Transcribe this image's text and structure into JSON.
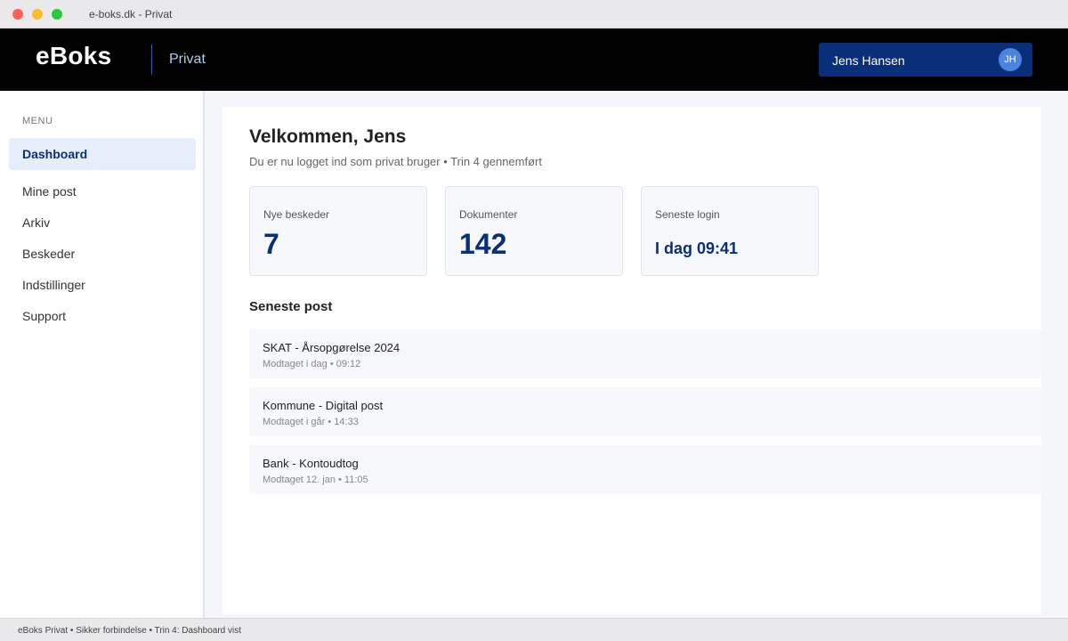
{
  "window": {
    "title": "e-boks.dk - Privat"
  },
  "header": {
    "logo": "eBoks",
    "section": "Privat",
    "user": {
      "name": "Jens Hansen",
      "initials": "JH"
    }
  },
  "sidebar": {
    "heading": "MENU",
    "items": [
      {
        "label": "Dashboard",
        "active": true
      },
      {
        "label": "Mine post"
      },
      {
        "label": "Arkiv"
      },
      {
        "label": "Beskeder"
      },
      {
        "label": "Indstillinger"
      },
      {
        "label": "Support"
      }
    ]
  },
  "main": {
    "title": "Velkommen, Jens",
    "subtitle": "Du er nu logget ind som privat bruger • Trin 4 gennemført",
    "stats": [
      {
        "label": "Nye beskeder",
        "value": "7"
      },
      {
        "label": "Dokumenter",
        "value": "142"
      },
      {
        "label": "Seneste login",
        "value": "I dag 09:41"
      }
    ],
    "recent_heading": "Seneste post",
    "recent": [
      {
        "title": "SKAT - Årsopgørelse 2024",
        "meta": "Modtaget i dag • 09:12"
      },
      {
        "title": "Kommune - Digital post",
        "meta": "Modtaget i går • 14:33"
      },
      {
        "title": "Bank - Kontoudtog",
        "meta": "Modtaget 12. jan • 11:05"
      }
    ]
  },
  "statusbar": {
    "text": "eBoks Privat • Sikker forbindelse • Trin 4: Dashboard vist"
  },
  "colors": {
    "brand_dark": "#0a2f7a",
    "header_bg": "#000000",
    "active_nav_bg": "#e6eefb",
    "avatar_bg": "#4a86df"
  }
}
